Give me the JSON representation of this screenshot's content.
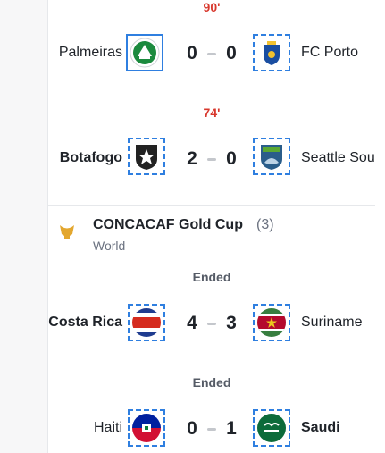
{
  "matches": [
    {
      "status": "90'",
      "home": "Palmeiras",
      "away": "FC Porto",
      "home_score": "0",
      "away_score": "0"
    },
    {
      "status": "74'",
      "home": "Botafogo",
      "away": "Seattle Sou",
      "home_score": "2",
      "away_score": "0"
    },
    {
      "status": "Ended",
      "home": "Costa Rica",
      "away": "Suriname",
      "home_score": "4",
      "away_score": "3"
    },
    {
      "status": "Ended",
      "home": "Haiti",
      "away": "Saudi",
      "home_score": "0",
      "away_score": "1"
    }
  ],
  "league": {
    "name": "CONCACAF Gold Cup",
    "count": "(3)",
    "region": "World",
    "logo_text": "GOLD CUP"
  },
  "icons": {
    "palmeiras": "palmeiras-crest-icon",
    "porto": "fc-porto-crest-icon",
    "botafogo": "botafogo-crest-icon",
    "seattle": "seattle-sounders-crest-icon",
    "costa_rica": "costa-rica-flag-icon",
    "suriname": "suriname-flag-icon",
    "haiti": "haiti-flag-icon",
    "saudi": "saudi-flag-icon"
  },
  "colors": {
    "live": "#d8382d",
    "selection": "#2f7fe0",
    "ended": "#555b66"
  }
}
